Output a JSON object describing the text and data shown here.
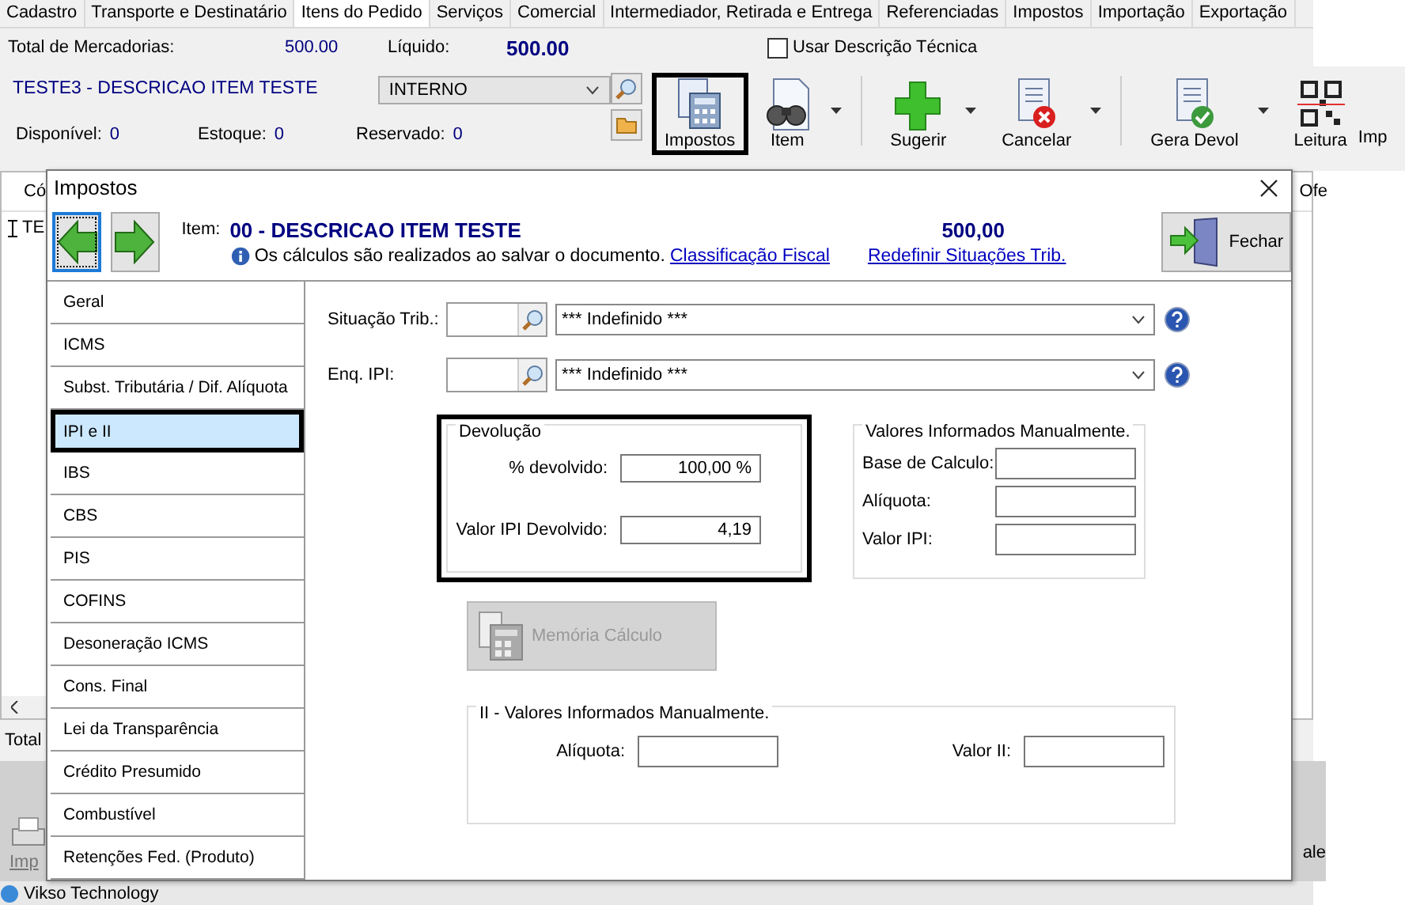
{
  "tabs": [
    {
      "label": "Cadastro",
      "selected": false
    },
    {
      "label": "Transporte e Destinatário",
      "selected": false
    },
    {
      "label": "Itens do Pedido",
      "selected": true
    },
    {
      "label": "Serviços",
      "selected": false
    },
    {
      "label": "Comercial",
      "selected": false
    },
    {
      "label": "Intermediador, Retirada e Entrega",
      "selected": false
    },
    {
      "label": "Referenciadas",
      "selected": false
    },
    {
      "label": "Impostos",
      "selected": false
    },
    {
      "label": "Importação",
      "selected": false
    },
    {
      "label": "Exportação",
      "selected": false
    }
  ],
  "totals": {
    "mercadorias_label": "Total de Mercadorias:",
    "mercadorias_value": "500.00",
    "liquido_label": "Líquido:",
    "liquido_value": "500.00"
  },
  "descricao_tecnica": {
    "label": "Usar Descrição Técnica",
    "checked": false
  },
  "item": {
    "description": "TESTE3 - DESCRICAO ITEM TESTE",
    "combo": "INTERNO",
    "stock": [
      {
        "label": "Disponível:",
        "value": "0"
      },
      {
        "label": "Estoque:",
        "value": "0"
      },
      {
        "label": "Reservado:",
        "value": "0"
      }
    ]
  },
  "toolbar": [
    {
      "label": "Impostos",
      "kind": "calculator",
      "highlighted": true,
      "dropdown": false,
      "separator_before": false
    },
    {
      "label": "Item",
      "kind": "binoculars",
      "highlighted": false,
      "dropdown": true,
      "separator_before": false
    },
    {
      "label": "Sugerir",
      "kind": "plus",
      "highlighted": false,
      "dropdown": true,
      "separator_before": true
    },
    {
      "label": "Cancelar",
      "kind": "cancel",
      "highlighted": false,
      "dropdown": true,
      "separator_before": false
    },
    {
      "label": "Gera Devol",
      "kind": "check",
      "highlighted": false,
      "dropdown": true,
      "separator_before": true
    },
    {
      "label": "Leitura",
      "kind": "qrcode",
      "highlighted": false,
      "dropdown": false,
      "separator_before": false
    },
    {
      "label": "Imp",
      "kind": "text",
      "highlighted": false,
      "dropdown": false,
      "separator_before": false
    }
  ],
  "grid": {
    "columns": [
      "Có",
      "Ofe"
    ],
    "rows": [
      [
        "TE"
      ]
    ]
  },
  "footer": {
    "total_label": "Total",
    "print_label": "Imp",
    "right_label": "ale",
    "status_text": "Vikso Technology"
  },
  "dialog": {
    "title": "Impostos",
    "item_label": "Item:",
    "item_description": "00 - DESCRICAO ITEM TESTE",
    "amount": "500,00",
    "info": "Os cálculos são realizados ao salvar o documento.",
    "links": [
      "Classificação Fiscal",
      "Redefinir Situações Trib."
    ],
    "close_button": "Fechar",
    "sidebar": [
      {
        "label": "Geral",
        "selected": false
      },
      {
        "label": "ICMS",
        "selected": false
      },
      {
        "label": "Subst. Tributária / Dif. Alíquota",
        "selected": false
      },
      {
        "label": "IPI e II",
        "selected": true
      },
      {
        "label": "IBS",
        "selected": false
      },
      {
        "label": "CBS",
        "selected": false
      },
      {
        "label": "PIS",
        "selected": false
      },
      {
        "label": "COFINS",
        "selected": false
      },
      {
        "label": "Desoneração ICMS",
        "selected": false
      },
      {
        "label": "Cons. Final",
        "selected": false
      },
      {
        "label": "Lei da Transparência",
        "selected": false
      },
      {
        "label": "Crédito Presumido",
        "selected": false
      },
      {
        "label": "Combustível",
        "selected": false
      },
      {
        "label": "Retenções Fed. (Produto)",
        "selected": false
      }
    ],
    "selects": [
      {
        "label": "Situação Trib.:",
        "value": "*** Indefinido ***"
      },
      {
        "label": "Enq. IPI:",
        "value": "*** Indefinido ***"
      }
    ],
    "devolucao": {
      "title": "Devolução",
      "highlighted": true,
      "fields": [
        {
          "label": "% devolvido:",
          "value": "100,00 %"
        },
        {
          "label": "Valor IPI Devolvido:",
          "value": "4,19"
        }
      ]
    },
    "manual": {
      "title": "Valores Informados Manualmente.",
      "fields": [
        {
          "label": "Base de Calculo:"
        },
        {
          "label": "Alíquota:"
        },
        {
          "label": "Valor IPI:"
        }
      ]
    },
    "memoria_button": {
      "label": "Memória Cálculo",
      "disabled": true
    },
    "ii": {
      "title": "II - Valores Informados Manualmente.",
      "fields": [
        {
          "label": "Alíquota:"
        },
        {
          "label": "Valor II:"
        }
      ]
    }
  }
}
